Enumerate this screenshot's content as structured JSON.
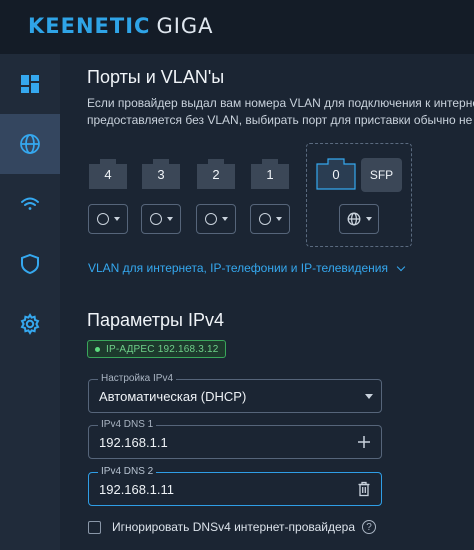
{
  "app": {
    "brand": "KEENETIC",
    "model": "GIGA"
  },
  "sidebar": {
    "items": [
      {
        "icon": "dashboard-icon"
      },
      {
        "icon": "globe-icon",
        "active": true
      },
      {
        "icon": "wifi-icon"
      },
      {
        "icon": "shield-icon"
      },
      {
        "icon": "gear-icon"
      }
    ]
  },
  "ports_section": {
    "title": "Порты и VLAN'ы",
    "description_line1": "Если провайдер выдал вам номера VLAN для подключения к интернет",
    "description_line2": "предоставляется без VLAN, выбирать порт для приставки обычно не",
    "ports": [
      "4",
      "3",
      "2",
      "1"
    ],
    "wan_port": "0",
    "sfp_label": "SFP",
    "vlan_link": "VLAN для интернета, IP-телефонии и IP-телевидения"
  },
  "ipv4_section": {
    "title": "Параметры IPv4",
    "ip_badge": "IP-АДРЕС 192.168.3.12",
    "settings_label": "Настройка IPv4",
    "settings_value": "Автоматическая (DHCP)",
    "dns1_label": "IPv4 DNS 1",
    "dns1_value": "192.168.1.1",
    "dns2_label": "IPv4 DNS 2",
    "dns2_value": "192.168.1.11",
    "ignore_dns_label": "Игнорировать DNSv4 интернет-провайдера"
  },
  "colors": {
    "accent": "#35a8ef",
    "brand": "#2fa4e7",
    "status_ok": "#6fd08a",
    "background": "#1b2533"
  }
}
